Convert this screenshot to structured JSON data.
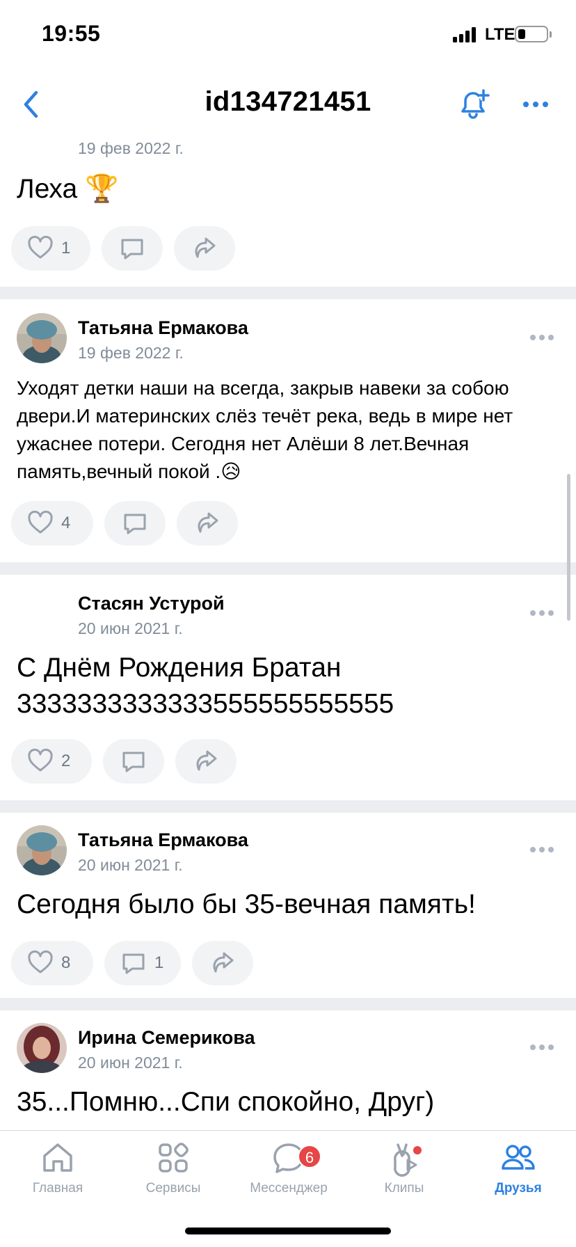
{
  "status_bar": {
    "time": "19:55",
    "network": "LTE"
  },
  "header": {
    "title": "id134721451"
  },
  "posts": [
    {
      "date": "19 фев 2022 г.",
      "text": "Леха 🏆",
      "likes": "1",
      "comments": ""
    },
    {
      "author": "Татьяна Ермакова",
      "date": "19 фев 2022 г.",
      "text": "Уходят детки наши на всегда, закрыв навеки за собою двери.И материнских слёз течёт река, ведь в мире нет ужаснее потери. Сегодня нет Алёши 8 лет.Вечная память,вечный покой .😥",
      "likes": "4",
      "comments": ""
    },
    {
      "author": "Стасян Устурой",
      "date": "20 июн 2021 г.",
      "text": "С Днём Рождения Братан 3333333333333555555555555",
      "likes": "2",
      "comments": ""
    },
    {
      "author": "Татьяна Ермакова",
      "date": "20 июн 2021 г.",
      "text": "Сегодня было бы 35-вечная память!",
      "likes": "8",
      "comments": "1"
    },
    {
      "author": "Ирина Семерикова",
      "date": "20 июн 2021 г.",
      "text": "35...Помню...Спи спокойно, Друг)"
    }
  ],
  "tabbar": {
    "items": [
      {
        "label": "Главная",
        "icon": "home-icon"
      },
      {
        "label": "Сервисы",
        "icon": "services-icon"
      },
      {
        "label": "Мессенджер",
        "icon": "messenger-icon",
        "badge": "6"
      },
      {
        "label": "Клипы",
        "icon": "clips-icon"
      },
      {
        "label": "Друзья",
        "icon": "friends-icon",
        "active": true
      }
    ]
  },
  "colors": {
    "accent": "#2d81e0",
    "secondary_text": "#818c99",
    "separator": "#ebedf0",
    "badge": "#e64646"
  }
}
